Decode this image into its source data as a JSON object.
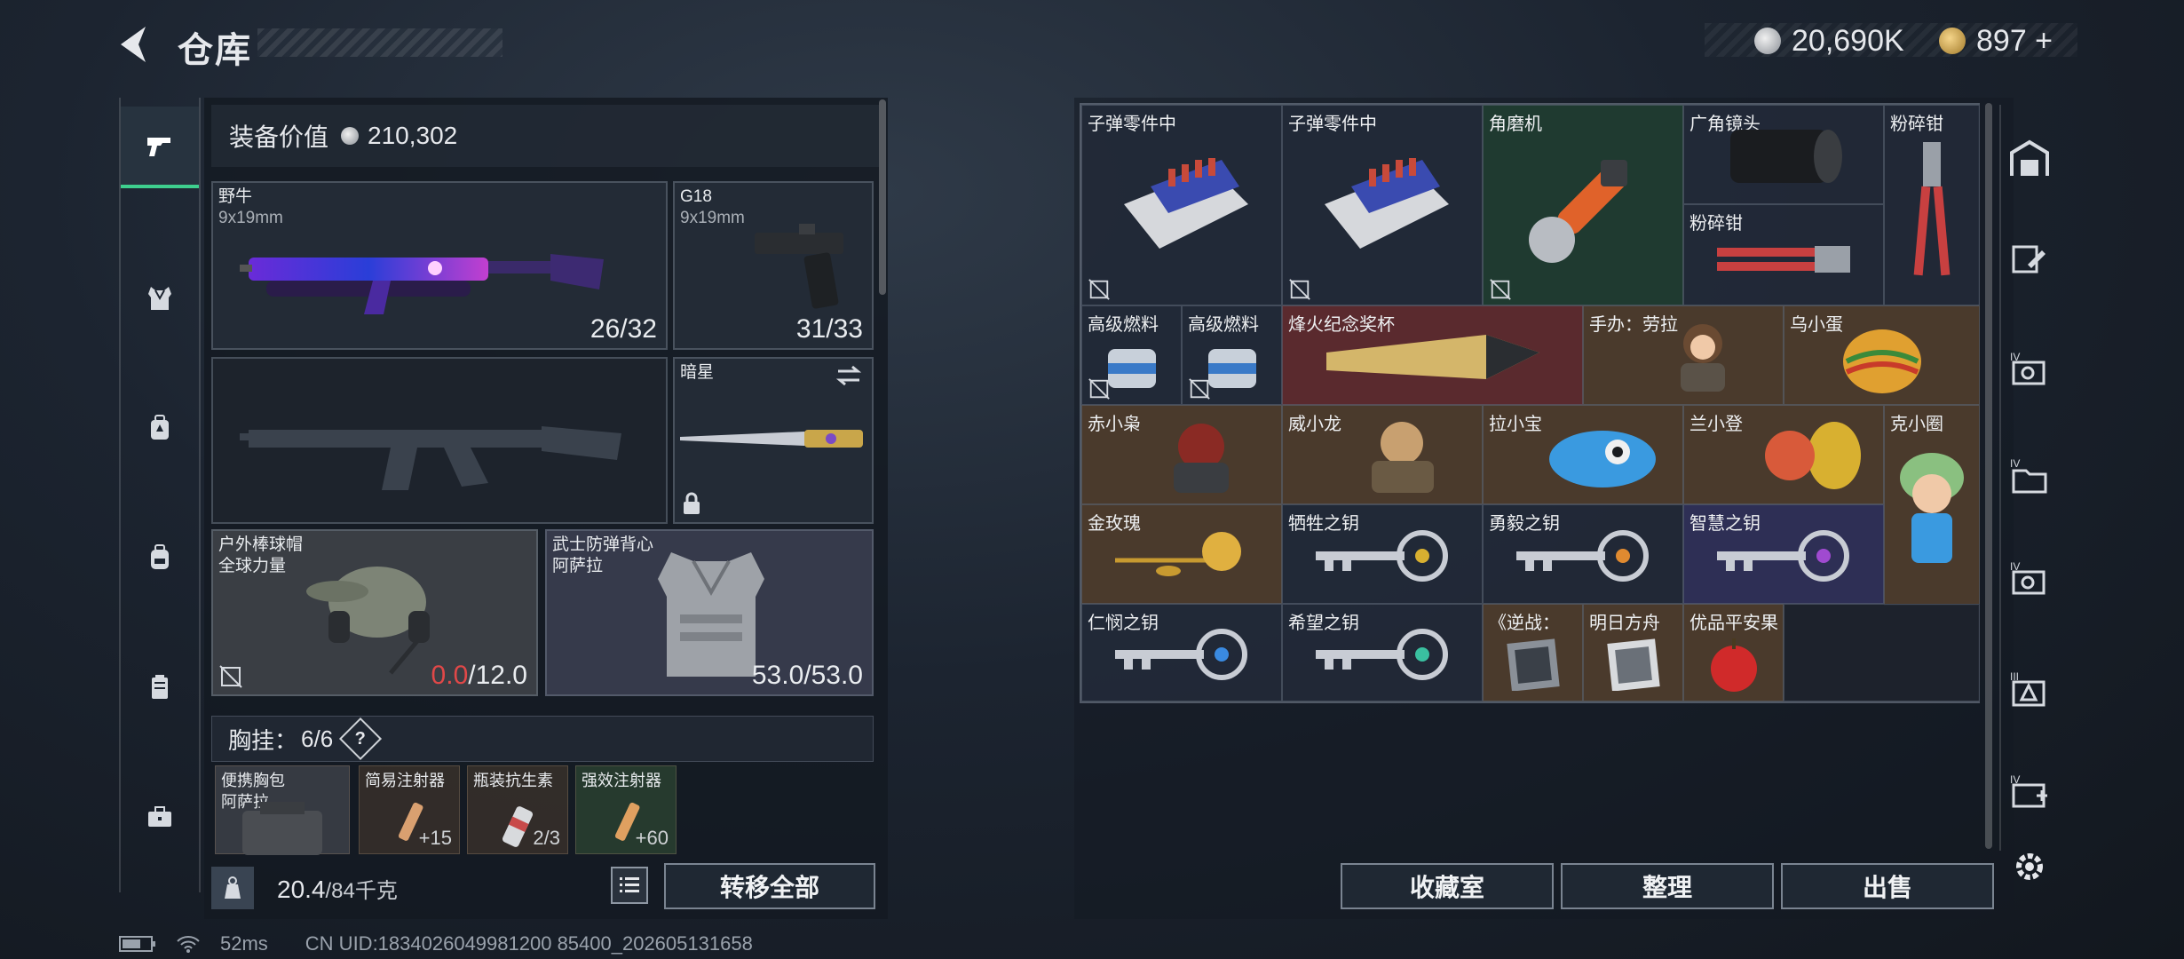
{
  "header": {
    "title": "仓库",
    "currency_silver": "20,690K",
    "currency_gold": "897 +"
  },
  "left_nav": [
    "pistol-icon",
    "vest-icon",
    "backpack-armor-icon",
    "backpack-icon",
    "case-icon",
    "toolbox-icon"
  ],
  "equip": {
    "value_label": "装备价值",
    "value": "210,302"
  },
  "slots": {
    "primary": {
      "name": "野牛",
      "ammo": "9x19mm",
      "count": "26/32"
    },
    "secondary": {
      "name": "G18",
      "ammo": "9x19mm",
      "count": "31/33"
    },
    "melee": {
      "name": "暗星"
    },
    "helmet": {
      "name": "户外棒球帽",
      "sub": "全球力量",
      "dur_cur": "0.0",
      "dur_max": "/12.0"
    },
    "armor": {
      "name": "武士防弹背心",
      "sub": "阿萨拉",
      "durability": "53.0/53.0"
    }
  },
  "chest": {
    "label": "胸挂：",
    "used": "6",
    "total": "/6",
    "help": "?",
    "items": [
      {
        "name": "便携胸包",
        "sub": "阿萨拉",
        "badge": ""
      },
      {
        "name": "简易注射器",
        "sub": "",
        "badge": "+15"
      },
      {
        "name": "瓶装抗生素",
        "sub": "",
        "badge": "2/3"
      },
      {
        "name": "强效注射器",
        "sub": "",
        "badge": "+60"
      }
    ]
  },
  "weight": {
    "current": "20.4",
    "max": "/84千克"
  },
  "buttons": {
    "transfer_all": "转移全部",
    "collection": "收藏室",
    "organize": "整理",
    "sell": "出售"
  },
  "stash": {
    "items": [
      {
        "name": "子弹零件中",
        "icon": "ammo-parts-icon"
      },
      {
        "name": "子弹零件中",
        "icon": "ammo-parts-icon"
      },
      {
        "name": "角磨机",
        "icon": "angle-grinder-icon"
      },
      {
        "name": "广角镜头",
        "icon": "lens-icon"
      },
      {
        "name": "粉碎钳",
        "icon": "pliers-icon"
      },
      {
        "name": "粉碎钳",
        "icon": "pliers-icon"
      },
      {
        "name": "高级燃料",
        "icon": "fuel-can-icon"
      },
      {
        "name": "高级燃料",
        "icon": "fuel-can-icon"
      },
      {
        "name": "烽火纪念奖杯",
        "icon": "trophy-icon"
      },
      {
        "name": "手办：劳拉",
        "icon": "figurine-icon"
      },
      {
        "name": "乌小蛋",
        "icon": "egg-figurine-icon"
      },
      {
        "name": "赤小枭",
        "icon": "figurine-icon"
      },
      {
        "name": "威小龙",
        "icon": "figurine-icon"
      },
      {
        "name": "拉小宝",
        "icon": "figurine-icon"
      },
      {
        "name": "兰小登",
        "icon": "figurine-icon"
      },
      {
        "name": "克小圈",
        "icon": "figurine-icon"
      },
      {
        "name": "金玫瑰",
        "icon": "golden-rose-icon"
      },
      {
        "name": "牺牲之钥",
        "icon": "key-icon"
      },
      {
        "name": "勇毅之钥",
        "icon": "key-icon"
      },
      {
        "name": "智慧之钥",
        "icon": "key-icon"
      },
      {
        "name": "仁悯之钥",
        "icon": "key-icon"
      },
      {
        "name": "希望之钥",
        "icon": "key-icon"
      },
      {
        "name": "《逆战：",
        "icon": "album-icon"
      },
      {
        "name": "明日方舟",
        "icon": "album-icon"
      },
      {
        "name": "优品平安果",
        "icon": "apple-icon"
      }
    ]
  },
  "status": {
    "ping": "52ms",
    "uid": "CN UID:1834026049981200 85400_202605131658"
  },
  "colors": {
    "accent": "#3ecf8e",
    "warning": "#e04848",
    "rare_orange": "#5a4330",
    "rare_red": "#5a2a2e",
    "rare_green": "#1f3a30",
    "rare_purple": "#2e2f55"
  }
}
